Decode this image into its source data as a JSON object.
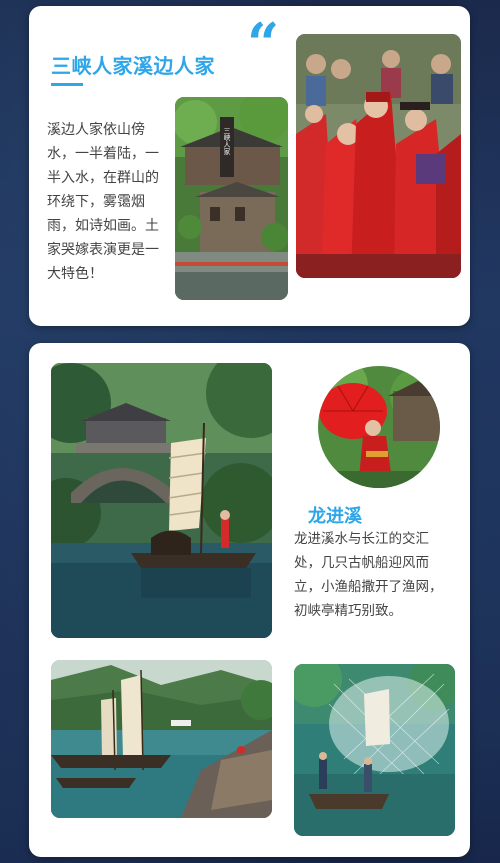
{
  "section_1": {
    "title": "三峡人家溪边人家",
    "quote_mark": "“",
    "description": "溪边人家依山傍水，一半着陆，一半入水，在群山的环绕下，雾霭烟雨，如诗如画。土家哭嫁表演更是一大特色！",
    "sign_text": "三峡人家"
  },
  "section_2": {
    "title": "龙进溪",
    "description": "龙进溪水与长江的交汇处，几只古帆船迎风而立，小渔船撒开了渔网，初峡亭精巧别致。"
  },
  "colors": {
    "accent": "#2fa6e8",
    "background": "#1e3158",
    "card": "#ffffff",
    "text": "#444444"
  }
}
